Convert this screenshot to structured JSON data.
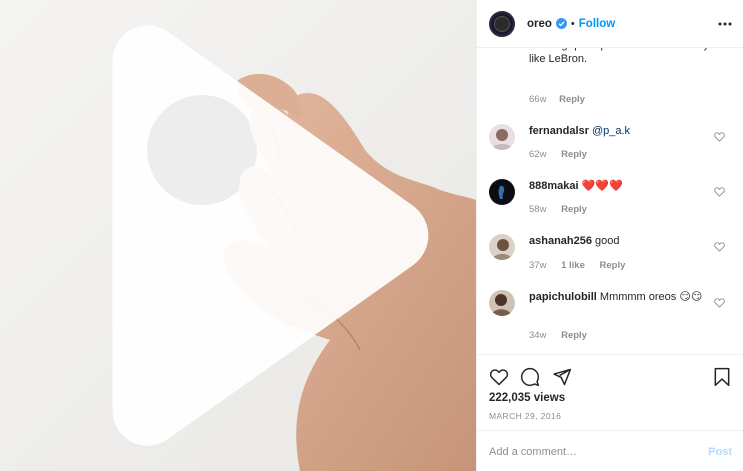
{
  "header": {
    "username": "oreo",
    "separator": "•",
    "follow_label": "Follow",
    "verified_icon": "verified-badge-icon",
    "more_icon": "more-options-icon"
  },
  "caption": {
    "text": "dunking quintuplet Oreo's ferociously like LeBron.",
    "time": "66w",
    "reply_label": "Reply"
  },
  "comments": [
    {
      "username": "fernandalsr",
      "text": "",
      "mention": "@p_a.k",
      "time": "62w",
      "likes": "",
      "reply_label": "Reply"
    },
    {
      "username": "888makai",
      "text": "❤️❤️❤️",
      "mention": "",
      "time": "58w",
      "likes": "",
      "reply_label": "Reply"
    },
    {
      "username": "ashanah256",
      "text": "good",
      "mention": "",
      "time": "37w",
      "likes": "1 like",
      "reply_label": "Reply"
    },
    {
      "username": "papichulobill",
      "text": "Mmmmm oreos 😏😏",
      "mention": "",
      "time": "34w",
      "likes": "",
      "reply_label": "Reply"
    }
  ],
  "actions": {
    "like_icon": "heart-icon",
    "comment_icon": "comment-icon",
    "share_icon": "share-icon",
    "save_icon": "bookmark-icon",
    "views": "222,035 views",
    "date": "MARCH 29, 2016"
  },
  "add_comment": {
    "placeholder": "Add a comment…",
    "post_label": "Post"
  },
  "media": {
    "play_icon": "play-icon"
  },
  "colors": {
    "accent": "#0095f6",
    "post_disabled": "#b3dbff",
    "muted": "#8e8e8e"
  }
}
